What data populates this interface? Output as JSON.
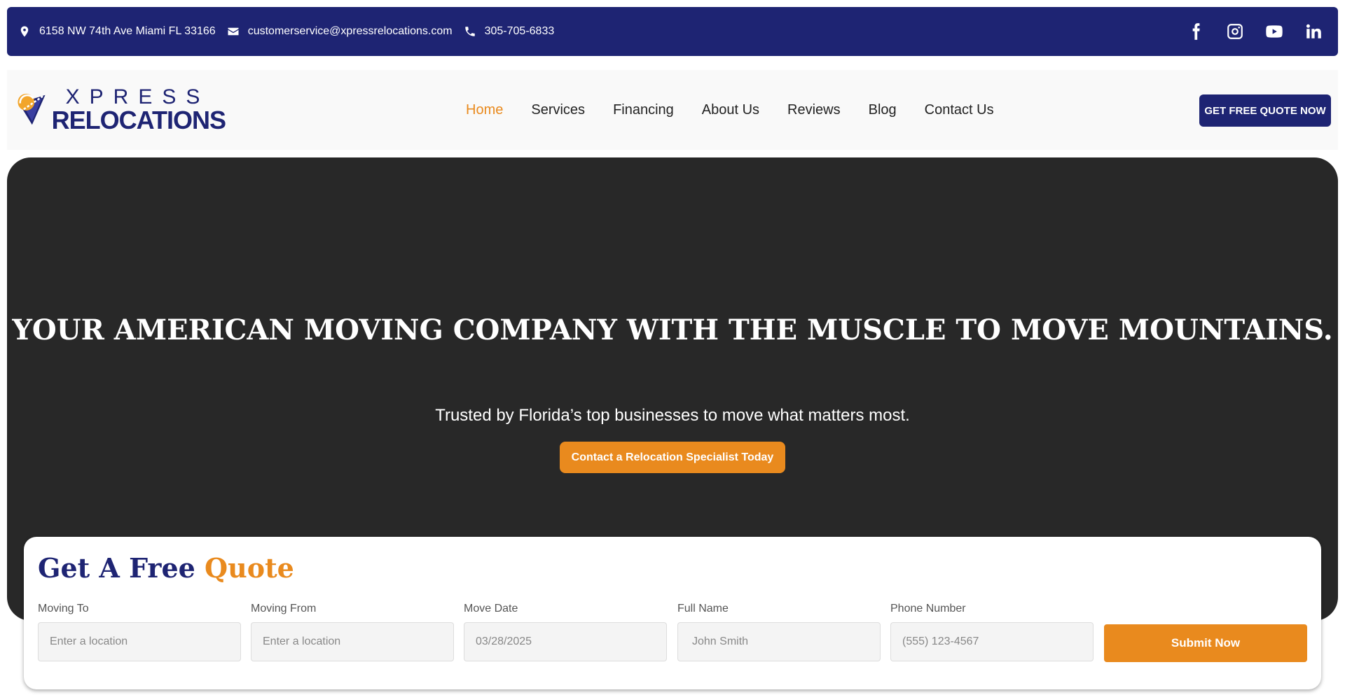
{
  "topbar": {
    "address": "6158 NW 74th Ave Miami FL 33166",
    "email": "customerservice@xpressrelocations.com",
    "phone": "305-705-6833",
    "social": [
      "facebook-icon",
      "instagram-icon",
      "youtube-icon",
      "linkedin-icon"
    ]
  },
  "logo": {
    "line1": "XPRESS",
    "line2": "RELOCATIONS"
  },
  "nav": {
    "items": [
      {
        "label": "Home",
        "active": true
      },
      {
        "label": "Services"
      },
      {
        "label": "Financing"
      },
      {
        "label": "About Us"
      },
      {
        "label": "Reviews"
      },
      {
        "label": "Blog"
      },
      {
        "label": "Contact Us"
      }
    ],
    "cta": "GET FREE QUOTE NOW"
  },
  "hero": {
    "title": "YOUR AMERICAN MOVING COMPANY WITH THE MUSCLE TO MOVE MOUNTAINS.",
    "subtitle": "Trusted by Florida’s top businesses to move what matters most.",
    "cta": "Contact a Relocation Specialist Today"
  },
  "quote_form": {
    "title_part1": "Get A Free ",
    "title_part2": "Quote",
    "fields": [
      {
        "label": "Moving To",
        "placeholder": "Enter a location"
      },
      {
        "label": "Moving From",
        "placeholder": "Enter a location"
      },
      {
        "label": "Move Date",
        "placeholder": "03/28/2025"
      },
      {
        "label": "Full Name",
        "placeholder": "John Smith"
      },
      {
        "label": "Phone Number",
        "placeholder": "(555) 123-4567"
      }
    ],
    "submit": "Submit Now"
  },
  "colors": {
    "brand_navy": "#1e2473",
    "accent_orange": "#e98a1e",
    "hero_bg": "#282828"
  }
}
